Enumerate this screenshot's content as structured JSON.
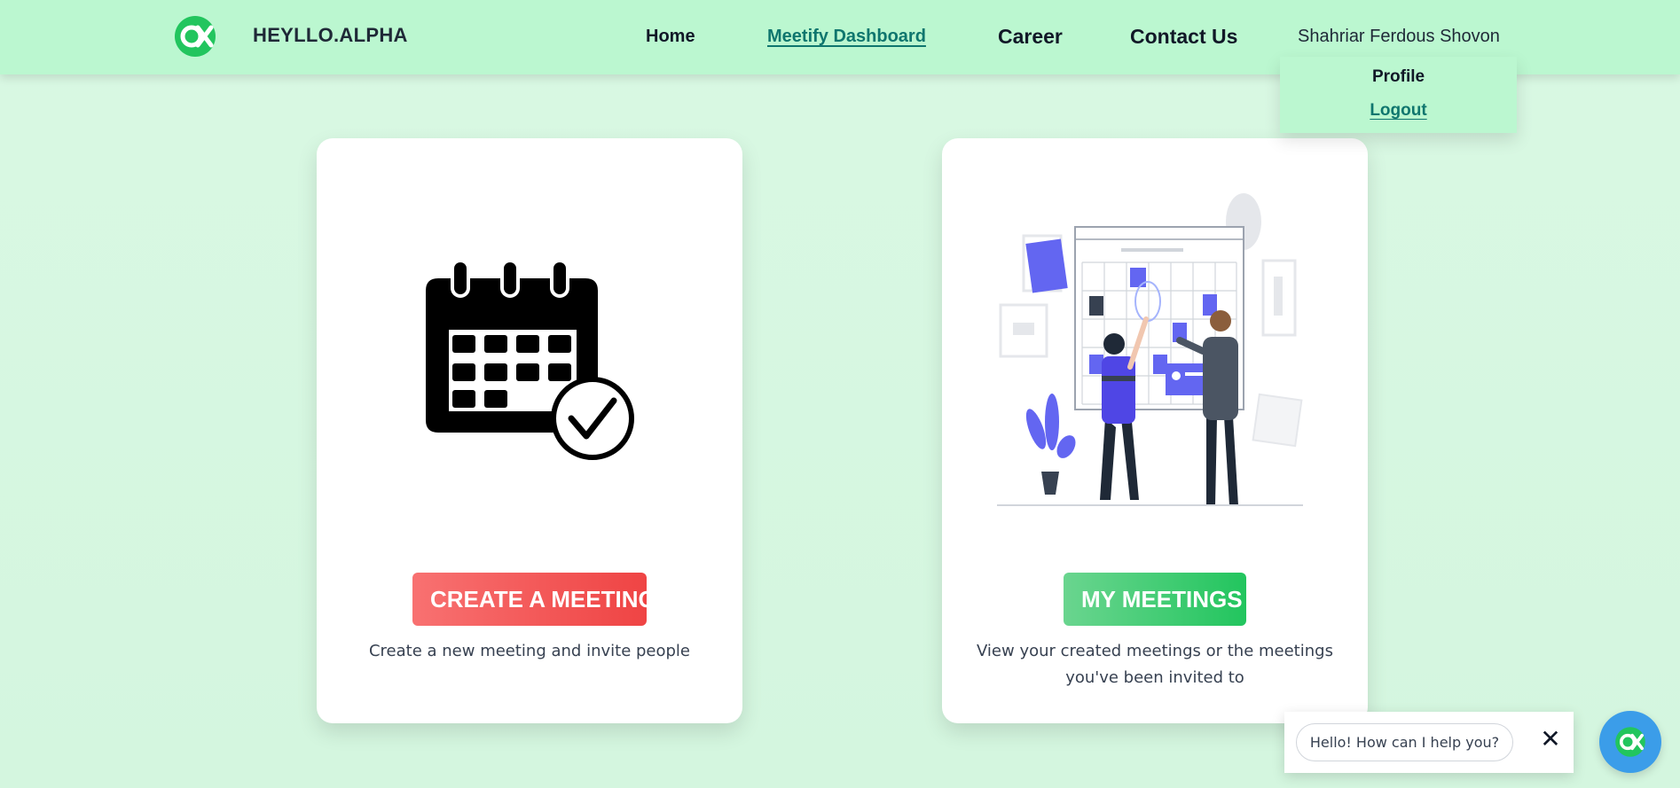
{
  "brand": {
    "name": "HEYLLO.ALPHA",
    "logo_icon": "heyllo-alpha-logo-icon",
    "color": "#22c55e"
  },
  "nav": {
    "home": "Home",
    "dashboard": "Meetify Dashboard",
    "career": "Career",
    "contact": "Contact Us",
    "user": "Shahriar Ferdous Shovon"
  },
  "dropdown": {
    "profile": "Profile",
    "logout": "Logout"
  },
  "cards": {
    "create": {
      "button": "CREATE A MEETING",
      "description": "Create a new meeting and invite people",
      "icon": "calendar-check-icon",
      "color": "#ef4444"
    },
    "mine": {
      "button": "MY MEETINGS",
      "description": "View your created meetings or the meetings you've been invited to",
      "illustration": "team-planning-illustration",
      "color": "#22c55e"
    }
  },
  "chat": {
    "greeting": "Hello! How can I help you?",
    "close_icon": "close-icon",
    "fab_icon": "chat-assistant-icon",
    "color": "#3b9de9"
  },
  "colors": {
    "background": "#d4f6df",
    "navbar": "#bbf7d0",
    "accent_link": "#0f766e"
  }
}
